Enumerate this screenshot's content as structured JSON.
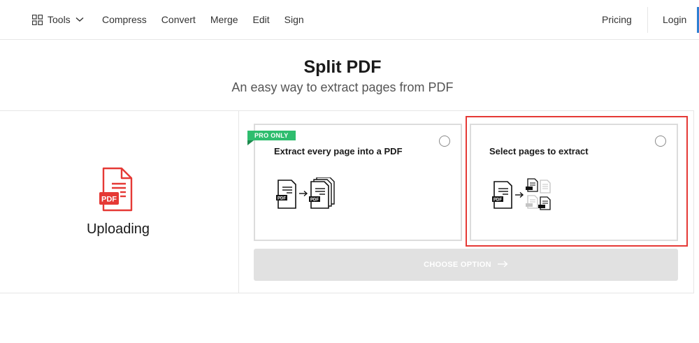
{
  "nav": {
    "tools_label": "Tools",
    "links": [
      "Compress",
      "Convert",
      "Merge",
      "Edit",
      "Sign"
    ],
    "pricing": "Pricing",
    "login": "Login"
  },
  "header": {
    "title": "Split PDF",
    "subtitle": "An easy way to extract pages from PDF"
  },
  "upload": {
    "status": "Uploading",
    "file_badge": "PDF"
  },
  "options": [
    {
      "badge": "PRO ONLY",
      "title": "Extract every page into a PDF",
      "icon": "extract-all-pages-icon",
      "selected": false
    },
    {
      "badge": "",
      "title": "Select pages to extract",
      "icon": "select-pages-icon",
      "selected": false
    }
  ],
  "actions": {
    "choose_label": "CHOOSE OPTION",
    "disabled": true
  },
  "colors": {
    "accent": "#2d7fd3",
    "pro_badge": "#2ebd6e",
    "pdf_red": "#e53935",
    "highlight": "#e53935",
    "button_disabled": "#e1e1e1"
  }
}
